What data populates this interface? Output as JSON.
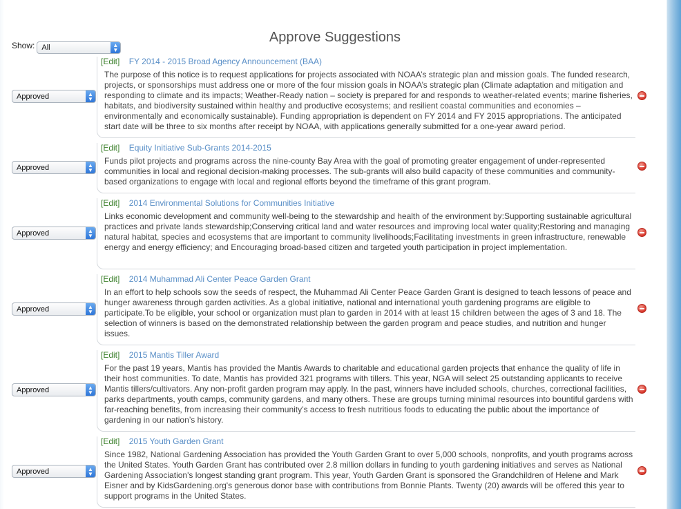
{
  "page": {
    "title": "Approve Suggestions",
    "show_label": "Show:",
    "show_value": "All"
  },
  "common": {
    "edit_label": "[Edit]",
    "status_value": "Approved"
  },
  "entries": [
    {
      "title": "FY 2014 - 2015 Broad Agency Announcement (BAA)",
      "desc": "The purpose of this notice is to request applications for projects associated with NOAA’s strategic plan and mission goals. The funded research, projects, or sponsorships must address one or more of the four mission goals in NOAA’s strategic plan (Climate adaptation and mitigation and responding to climate and its impacts; Weather-Ready nation – society is prepared for and responds to weather-related events; marine fisheries, habitats, and biodiversity sustained within healthy and productive ecosystems; and resilient coastal communities and economies – environmentally and economically sustainable). Funding appropriation is dependent on FY 2014 and FY 2015 appropriations. The anticipated start date will be three to six months after receipt by NOAA, with applications generally submitted for a one-year award period."
    },
    {
      "title": "Equity Initiative Sub-Grants 2014-2015",
      "desc": "Funds pilot projects and programs across the nine-county Bay Area with the goal of promoting greater engagement of under-represented communities in local and regional decision-making processes. The sub-grants will also build capacity of these communities and community-based organizations to engage with local and regional efforts beyond the timeframe of this grant program."
    },
    {
      "title": "2014 Environmental Solutions for Communities Initiative",
      "desc": "Links economic development and community well-being to the stewardship and health of the environment by:Supporting sustainable agricultural practices and private lands stewardship;Conserving critical land and water resources and improving local water quality;Restoring and managing natural habitat, species and ecosystems that are important to community livelihoods;Facilitating investments in green infrastructure, renewable energy and energy efficiency; and Encouraging broad-based citizen and targeted youth participation in project implementation."
    },
    {
      "title": "2014 Muhammad Ali Center Peace Garden Grant",
      "desc": "In an effort to help schools sow the seeds of respect, the Muhammad Ali Center Peace Garden Grant is designed to teach lessons of peace and hunger awareness through garden activities. As a global initiative, national and international youth gardening programs are eligible to participate.To be eligible, your school or organization must plan to garden in 2014 with at least 15 children between the ages of 3 and 18. The selection of winners is based on the demonstrated relationship between the garden program and peace studies, and nutrition and hunger issues."
    },
    {
      "title": "2015 Mantis Tiller Award",
      "desc": "For the past 19 years, Mantis has provided the Mantis Awards to charitable and educational garden projects that enhance the quality of life in their host communities. To date, Mantis has provided 321 programs with tillers. This year, NGA will select 25 outstanding applicants to receive Mantis tillers/cultivators. Any non-profit garden program may apply. In the past, winners have included schools, churches, correctional facilities, parks departments, youth camps, community gardens, and many others. These are groups turning minimal resources into bountiful gardens with far-reaching benefits, from increasing their community’s access to fresh nutritious foods to educating the public about the importance of gardening in our nation’s history."
    },
    {
      "title": "2015 Youth Garden Grant",
      "desc": "Since 1982, National Gardening Association has provided the Youth Garden Grant to over 5,000 schools, nonprofits, and youth programs across the United States. Youth Garden Grant has contributed over 2.8 million dollars in funding to youth gardening initiatives and serves as National Gardening Association's longest standing grant program. This year, Youth Garden Grant is sponsored the Grandchildren of Helene and Mark Eisner and by KidsGardening.org's generous donor base with contributions from Bonnie Plants. Twenty (20) awards will be offered this year to support programs in the United States."
    }
  ]
}
